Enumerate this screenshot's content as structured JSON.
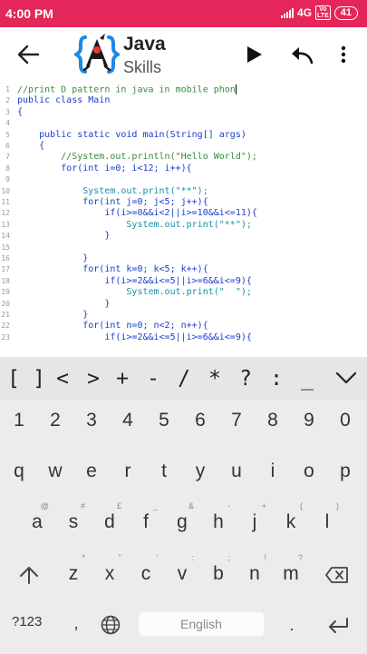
{
  "status": {
    "time": "4:00 PM",
    "network": "4G",
    "volte": [
      "Vo",
      "LTE"
    ],
    "battery": "41"
  },
  "appbar": {
    "title_line1": "Java",
    "title_line2": "Skills"
  },
  "editor": {
    "lines": [
      {
        "n": "1",
        "text": "//print D pattern in java in mobile phon",
        "type": "cm",
        "cursor": true
      },
      {
        "n": "2",
        "text": "public class Main",
        "type": "kw"
      },
      {
        "n": "3",
        "text": "{",
        "type": "kw"
      },
      {
        "n": "4",
        "text": "",
        "type": "kw"
      },
      {
        "n": "5",
        "text": "    public static void main(String[] args)",
        "type": "kw"
      },
      {
        "n": "6",
        "text": "    {",
        "type": "kw"
      },
      {
        "n": "7",
        "text": "        //System.out.println(\"Hello World\");",
        "type": "cm"
      },
      {
        "n": "8",
        "text": "        for(int i=0; i<12; i++){",
        "type": "kw"
      },
      {
        "n": "9",
        "text": "",
        "type": "kw"
      },
      {
        "n": "10",
        "text": "            System.out.print(\"**\");",
        "type": "cls"
      },
      {
        "n": "11",
        "text": "            for(int j=0; j<5; j++){",
        "type": "kw"
      },
      {
        "n": "12",
        "text": "                if(i>=0&&i<2||i>=10&&i<=11){",
        "type": "kw"
      },
      {
        "n": "13",
        "text": "                    System.out.print(\"**\");",
        "type": "cls"
      },
      {
        "n": "14",
        "text": "                }",
        "type": "kw"
      },
      {
        "n": "15",
        "text": "",
        "type": "kw"
      },
      {
        "n": "16",
        "text": "            }",
        "type": "kw"
      },
      {
        "n": "17",
        "text": "            for(int k=0; k<5; k++){",
        "type": "kw"
      },
      {
        "n": "18",
        "text": "                if(i>=2&&i<=5||i>=6&&i<=9){",
        "type": "kw"
      },
      {
        "n": "19",
        "text": "                    System.out.print(\"  \");",
        "type": "cls"
      },
      {
        "n": "20",
        "text": "                }",
        "type": "kw"
      },
      {
        "n": "21",
        "text": "            }",
        "type": "kw"
      },
      {
        "n": "22",
        "text": "            for(int n=0; n<2; n++){",
        "type": "kw"
      },
      {
        "n": "23",
        "text": "                if(i>=2&&i<=5||i>=6&&i<=9){",
        "type": "kw"
      }
    ]
  },
  "symbols": [
    "[",
    "]",
    "<",
    ">",
    "+",
    "-",
    "/",
    "*",
    "?",
    ":",
    "_"
  ],
  "keyboard": {
    "row_numbers": [
      "1",
      "2",
      "3",
      "4",
      "5",
      "6",
      "7",
      "8",
      "9",
      "0"
    ],
    "row_q": [
      {
        "k": "q",
        "h": ""
      },
      {
        "k": "w",
        "h": ""
      },
      {
        "k": "e",
        "h": ""
      },
      {
        "k": "r",
        "h": ""
      },
      {
        "k": "t",
        "h": ""
      },
      {
        "k": "y",
        "h": ""
      },
      {
        "k": "u",
        "h": ""
      },
      {
        "k": "i",
        "h": ""
      },
      {
        "k": "o",
        "h": ""
      },
      {
        "k": "p",
        "h": ""
      }
    ],
    "row_a": [
      {
        "k": "a",
        "h": "@"
      },
      {
        "k": "s",
        "h": "#"
      },
      {
        "k": "d",
        "h": "£"
      },
      {
        "k": "f",
        "h": "_"
      },
      {
        "k": "g",
        "h": "&"
      },
      {
        "k": "h",
        "h": "-"
      },
      {
        "k": "j",
        "h": "+"
      },
      {
        "k": "k",
        "h": "("
      },
      {
        "k": "l",
        "h": ")"
      }
    ],
    "row_z": [
      {
        "k": "z",
        "h": "*"
      },
      {
        "k": "x",
        "h": "\""
      },
      {
        "k": "c",
        "h": "'"
      },
      {
        "k": "v",
        "h": ":"
      },
      {
        "k": "b",
        "h": ";"
      },
      {
        "k": "n",
        "h": "!"
      },
      {
        "k": "m",
        "h": "?"
      }
    ],
    "sym_key": "?123",
    "comma": ",",
    "space_label": "English",
    "period": "."
  },
  "colors": {
    "statusbar": "#e5265a",
    "code_keyword": "#1a3dcc",
    "code_comment": "#3a8a3a",
    "code_class": "#1a8fa8"
  }
}
